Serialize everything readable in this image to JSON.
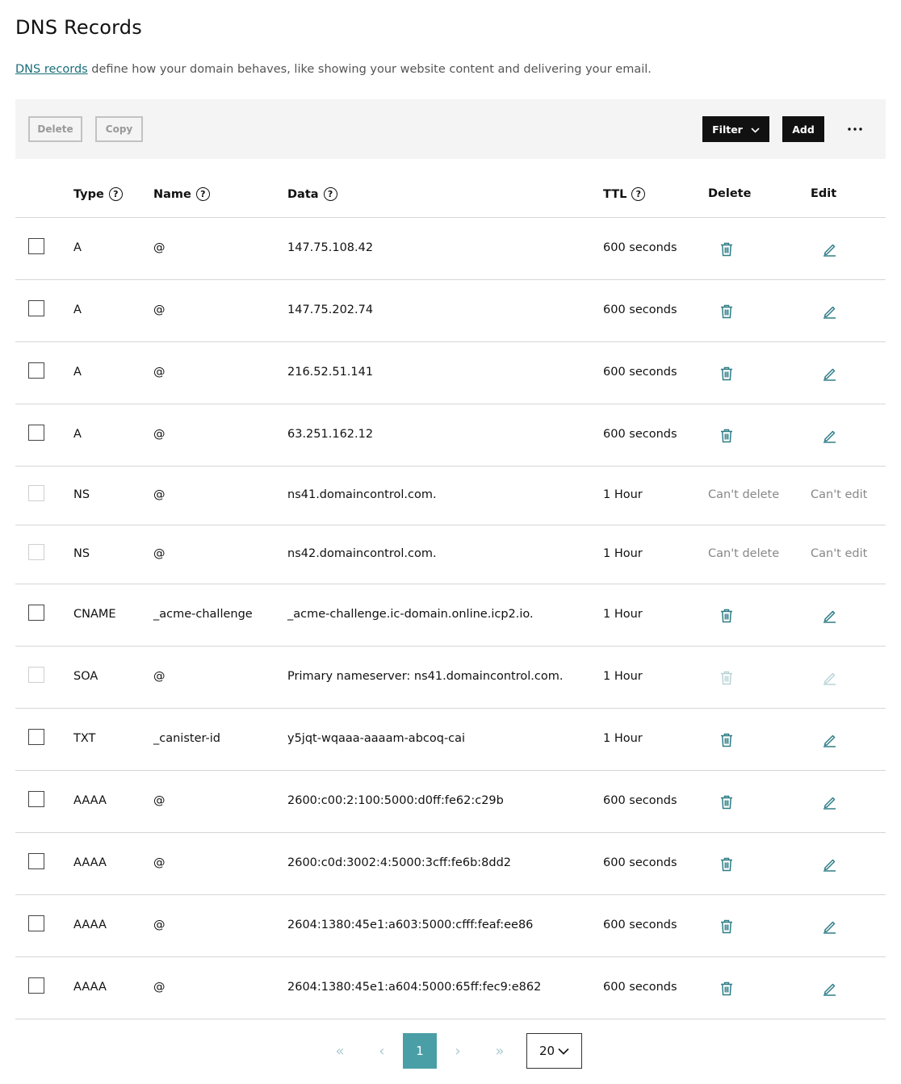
{
  "page": {
    "title": "DNS Records",
    "intro_link": "DNS records",
    "intro_text": " define how your domain behaves, like showing your website content and delivering your email."
  },
  "toolbar": {
    "delete_label": "Delete",
    "copy_label": "Copy",
    "filter_label": "Filter",
    "add_label": "Add"
  },
  "columns": {
    "type": "Type",
    "name": "Name",
    "data": "Data",
    "ttl": "TTL",
    "delete": "Delete",
    "edit": "Edit",
    "help_glyph": "?"
  },
  "records": [
    {
      "type": "A",
      "name": "@",
      "data": "147.75.108.42",
      "ttl": "600 seconds",
      "deletable": true,
      "editable": true,
      "checkbox_enabled": true
    },
    {
      "type": "A",
      "name": "@",
      "data": "147.75.202.74",
      "ttl": "600 seconds",
      "deletable": true,
      "editable": true,
      "checkbox_enabled": true
    },
    {
      "type": "A",
      "name": "@",
      "data": "216.52.51.141",
      "ttl": "600 seconds",
      "deletable": true,
      "editable": true,
      "checkbox_enabled": true
    },
    {
      "type": "A",
      "name": "@",
      "data": "63.251.162.12",
      "ttl": "600 seconds",
      "deletable": true,
      "editable": true,
      "checkbox_enabled": true
    },
    {
      "type": "NS",
      "name": "@",
      "data": "ns41.domaincontrol.com.",
      "ttl": "1 Hour",
      "deletable": false,
      "editable": false,
      "checkbox_enabled": false,
      "delete_text": "Can't delete",
      "edit_text": "Can't edit"
    },
    {
      "type": "NS",
      "name": "@",
      "data": "ns42.domaincontrol.com.",
      "ttl": "1 Hour",
      "deletable": false,
      "editable": false,
      "checkbox_enabled": false,
      "delete_text": "Can't delete",
      "edit_text": "Can't edit"
    },
    {
      "type": "CNAME",
      "name": "_acme-challenge",
      "data": "_acme-challenge.ic-domain.online.icp2.io.",
      "ttl": "1 Hour",
      "deletable": true,
      "editable": true,
      "checkbox_enabled": true
    },
    {
      "type": "SOA",
      "name": "@",
      "data": "Primary nameserver: ns41.domaincontrol.com.",
      "ttl": "1 Hour",
      "deletable": "disabled",
      "editable": "disabled",
      "checkbox_enabled": false
    },
    {
      "type": "TXT",
      "name": "_canister-id",
      "data": "y5jqt-wqaaa-aaaam-abcoq-cai",
      "ttl": "1 Hour",
      "deletable": true,
      "editable": true,
      "checkbox_enabled": true
    },
    {
      "type": "AAAA",
      "name": "@",
      "data": "2600:c00:2:100:5000:d0ff:fe62:c29b",
      "ttl": "600 seconds",
      "deletable": true,
      "editable": true,
      "checkbox_enabled": true
    },
    {
      "type": "AAAA",
      "name": "@",
      "data": "2600:c0d:3002:4:5000:3cff:fe6b:8dd2",
      "ttl": "600 seconds",
      "deletable": true,
      "editable": true,
      "checkbox_enabled": true
    },
    {
      "type": "AAAA",
      "name": "@",
      "data": "2604:1380:45e1:a603:5000:cfff:feaf:ee86",
      "ttl": "600 seconds",
      "deletable": true,
      "editable": true,
      "checkbox_enabled": true
    },
    {
      "type": "AAAA",
      "name": "@",
      "data": "2604:1380:45e1:a604:5000:65ff:fec9:e862",
      "ttl": "600 seconds",
      "deletable": true,
      "editable": true,
      "checkbox_enabled": true
    }
  ],
  "pagination": {
    "first_glyph": "«",
    "prev_glyph": "‹",
    "next_glyph": "›",
    "last_glyph": "»",
    "current_page": "1",
    "page_size": "20"
  },
  "colors": {
    "accent": "#1b6e7a",
    "icon_teal": "#2f7d86",
    "icon_disabled": "#b9d3d7",
    "current_page_bg": "#4a9ea6"
  },
  "icons": [
    "help-icon",
    "chevron-down-icon",
    "more-icon",
    "trash-icon",
    "pencil-icon",
    "first-page-icon",
    "prev-page-icon",
    "next-page-icon",
    "last-page-icon"
  ]
}
